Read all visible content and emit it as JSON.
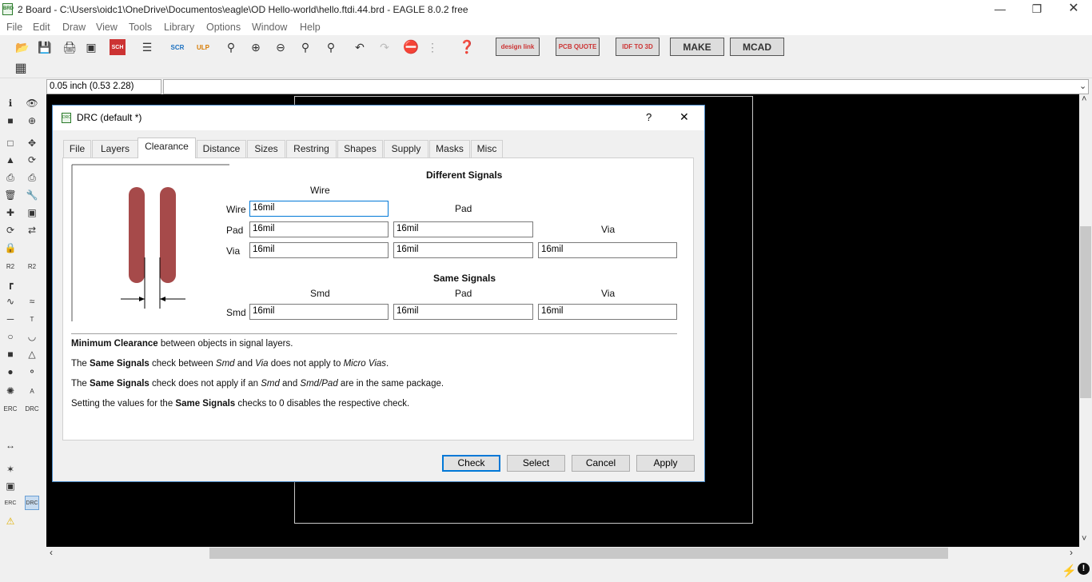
{
  "window": {
    "title": "2 Board - C:\\Users\\oidc1\\OneDrive\\Documentos\\eagle\\OD Hello-world\\hello.ftdi.44.brd - EAGLE 8.0.2 free"
  },
  "menu": [
    "File",
    "Edit",
    "Draw",
    "View",
    "Tools",
    "Library",
    "Options",
    "Window",
    "Help"
  ],
  "toolbar": {
    "brands": [
      "design link",
      "PCB QUOTE",
      "IDF TO 3D",
      "MAKE",
      "MCAD"
    ]
  },
  "coord": "0.05 inch (0.53 2.28)",
  "dialog": {
    "title": "DRC (default *)",
    "help": "?",
    "close": "✕",
    "tabs": [
      "File",
      "Layers",
      "Clearance",
      "Distance",
      "Sizes",
      "Restring",
      "Shapes",
      "Supply",
      "Masks",
      "Misc"
    ],
    "different_signals": {
      "heading": "Different Signals",
      "col_wire": "Wire",
      "col_pad": "Pad",
      "col_via": "Via",
      "row_wire": "Wire",
      "row_pad": "Pad",
      "row_via": "Via",
      "wire_wire": "16mil",
      "pad_wire": "16mil",
      "pad_pad": "16mil",
      "via_wire": "16mil",
      "via_pad": "16mil",
      "via_via": "16mil"
    },
    "same_signals": {
      "heading": "Same Signals",
      "col_smd": "Smd",
      "col_pad": "Pad",
      "col_via": "Via",
      "row_smd": "Smd",
      "smd_smd": "16mil",
      "smd_pad": "16mil",
      "smd_via": "16mil"
    },
    "desc": {
      "l1_b": "Minimum Clearance",
      "l1_r": " between objects in signal layers.",
      "l2_a": "The ",
      "l2_b": "Same Signals",
      "l2_c": " check between ",
      "l2_i1": "Smd",
      "l2_d": " and ",
      "l2_i2": "Via",
      "l2_e": " does not apply to ",
      "l2_i3": "Micro Vias",
      "l2_f": ".",
      "l3_a": "The ",
      "l3_b": "Same Signals",
      "l3_c": " check does not apply if an ",
      "l3_i1": "Smd",
      "l3_d": " and ",
      "l3_i2": "Smd/Pad",
      "l3_e": " are in the same package.",
      "l4_a": "Setting the values for the ",
      "l4_b": "Same Signals",
      "l4_c": " checks to 0 disables the respective check."
    },
    "buttons": {
      "check": "Check",
      "select": "Select",
      "cancel": "Cancel",
      "apply": "Apply"
    }
  },
  "colors": {
    "canvas": "#000000",
    "pad": "#a64a4a",
    "accent": "#0078d7"
  },
  "left_tools": [
    "info-icon",
    "eye-icon",
    "layer-icon",
    "mark-icon",
    "select-icon",
    "move-icon",
    "mirror-icon",
    "rotate-icon",
    "copy-icon",
    "paste-icon",
    "delete-icon",
    "wrench-icon",
    "add-icon",
    "group-icon",
    "replace-icon",
    "split-icon",
    "lock-icon",
    "swap-icon",
    "name-icon",
    "value-icon",
    "miter-icon",
    "arc-icon",
    "meander-icon",
    "route-icon",
    "wire-icon",
    "text-icon",
    "circle-icon",
    "arc2-icon",
    "rect-icon",
    "polygon-icon",
    "via-icon",
    "hole-icon",
    "ratsnest-icon",
    "signal-icon",
    "erc-icon",
    "drc-icon"
  ]
}
